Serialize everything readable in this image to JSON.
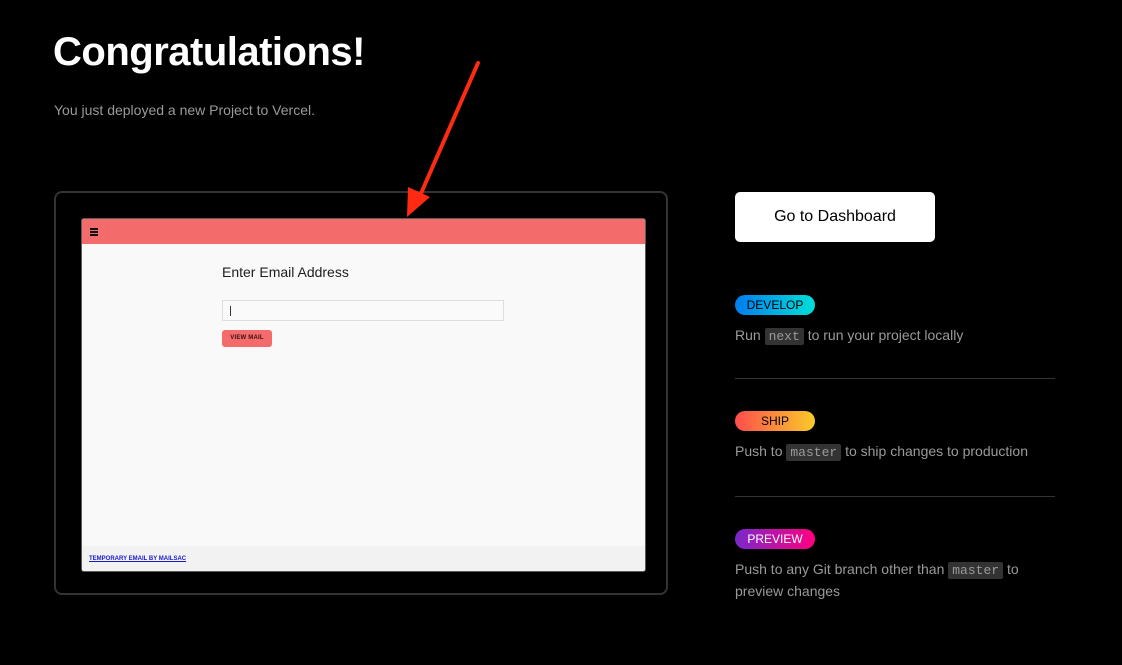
{
  "header": {
    "title": "Congratulations!",
    "subtitle": "You just deployed a new Project to Vercel."
  },
  "preview": {
    "heading": "Enter Email Address",
    "input_value": "",
    "button_label": "VIEW MAIL",
    "footer_link": "TEMPORARY EMAIL BY MAILSAC",
    "menu_icon": "hamburger-menu-icon",
    "accent_color": "#f46b6b",
    "annotation_arrow_color": "#ff2a12"
  },
  "actions": {
    "dashboard_label": "Go to Dashboard"
  },
  "steps": [
    {
      "badge": "DEVELOP",
      "text_before": "Run",
      "code": "next",
      "text_after": "to run your project locally"
    },
    {
      "badge": "SHIP",
      "text_before": "Push to",
      "code": "master",
      "text_after": "to ship changes to production"
    },
    {
      "badge": "PREVIEW",
      "text_before": "Push to any Git branch other than",
      "code": "master",
      "text_after": "to preview changes"
    }
  ]
}
